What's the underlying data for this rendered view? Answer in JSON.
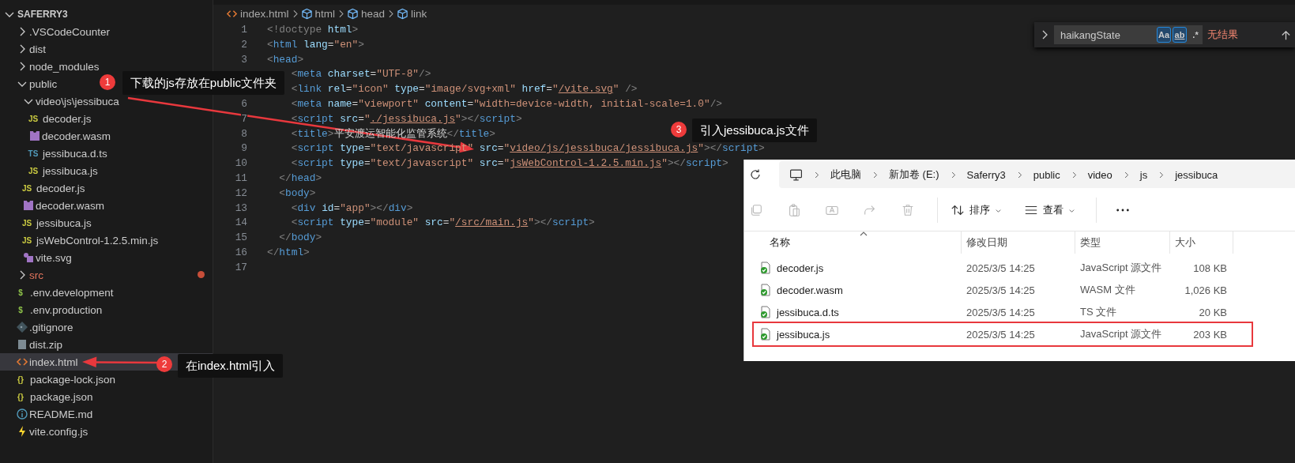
{
  "sidebar": {
    "root": {
      "title": "SAFERRY3",
      "expanded": true
    },
    "items": [
      {
        "name": ".VSCodeCounter",
        "kind": "folder",
        "expanded": false,
        "selected": false,
        "modified": false
      },
      {
        "name": "dist",
        "kind": "folder",
        "expanded": false,
        "selected": false,
        "modified": false
      },
      {
        "name": "node_modules",
        "kind": "folder",
        "expanded": false,
        "selected": false,
        "modified": false
      },
      {
        "name": "public",
        "kind": "folder",
        "expanded": true,
        "selected": false,
        "modified": false,
        "children": [
          {
            "name": "video\\js\\jessibuca",
            "kind": "folder",
            "expanded": true,
            "selected": false,
            "modified": false,
            "children": [
              {
                "name": "decoder.js",
                "kind": "js",
                "icon_text": "JS",
                "selected": false,
                "modified": false
              },
              {
                "name": "decoder.wasm",
                "kind": "wasm",
                "selected": false,
                "modified": false
              },
              {
                "name": "jessibuca.d.ts",
                "kind": "ts",
                "icon_text": "TS",
                "selected": false,
                "modified": false
              },
              {
                "name": "jessibuca.js",
                "kind": "js",
                "icon_text": "JS",
                "selected": false,
                "modified": false
              }
            ]
          },
          {
            "name": "decoder.js",
            "kind": "js",
            "icon_text": "JS",
            "selected": false,
            "modified": false
          },
          {
            "name": "decoder.wasm",
            "kind": "wasm",
            "selected": false,
            "modified": false
          },
          {
            "name": "jessibuca.js",
            "kind": "js",
            "icon_text": "JS",
            "selected": false,
            "modified": false
          },
          {
            "name": "jsWebControl-1.2.5.min.js",
            "kind": "js",
            "icon_text": "JS",
            "selected": false,
            "modified": false
          },
          {
            "name": "vite.svg",
            "kind": "svg",
            "selected": false,
            "modified": false
          }
        ]
      },
      {
        "name": "src",
        "kind": "folder",
        "expanded": false,
        "selected": false,
        "modified": true
      },
      {
        "name": ".env.development",
        "kind": "env",
        "icon_text": "$",
        "selected": false,
        "modified": false
      },
      {
        "name": ".env.production",
        "kind": "env",
        "icon_text": "$",
        "selected": false,
        "modified": false
      },
      {
        "name": ".gitignore",
        "kind": "git",
        "selected": false,
        "modified": false
      },
      {
        "name": "dist.zip",
        "kind": "zip",
        "selected": false,
        "modified": false
      },
      {
        "name": "index.html",
        "kind": "html",
        "selected": true,
        "modified": false
      },
      {
        "name": "package-lock.json",
        "kind": "json",
        "icon_text": "{}",
        "selected": false,
        "modified": false
      },
      {
        "name": "package.json",
        "kind": "json",
        "icon_text": "{}",
        "selected": false,
        "modified": false
      },
      {
        "name": "README.md",
        "kind": "info",
        "selected": false,
        "modified": false
      },
      {
        "name": "vite.config.js",
        "kind": "vite",
        "selected": false,
        "modified": false
      }
    ]
  },
  "breadcrumb": [
    {
      "kind": "file",
      "label": "index.html"
    },
    {
      "kind": "element",
      "label": "html"
    },
    {
      "kind": "element",
      "label": "head"
    },
    {
      "kind": "element",
      "label": "link"
    }
  ],
  "editor": {
    "lines": [
      {
        "number": "1",
        "tokens": [
          {
            "kind": "p",
            "text": "<!doctype"
          },
          {
            "kind": "attr",
            "text": " html"
          },
          {
            "kind": "p",
            "text": ">"
          }
        ]
      },
      {
        "number": "2",
        "tokens": [
          {
            "kind": "p",
            "text": "<"
          },
          {
            "kind": "tag",
            "text": "html"
          },
          {
            "kind": "attr",
            "text": " lang"
          },
          {
            "kind": "t",
            "text": "="
          },
          {
            "kind": "str",
            "text": "\"en\""
          },
          {
            "kind": "p",
            "text": ">"
          }
        ]
      },
      {
        "number": "3",
        "tokens": [
          {
            "kind": "p",
            "text": "<"
          },
          {
            "kind": "tag",
            "text": "head"
          },
          {
            "kind": "p",
            "text": ">"
          }
        ]
      },
      {
        "tokens": [
          {
            "kind": "p",
            "text": "    <"
          },
          {
            "kind": "tag",
            "text": "meta"
          },
          {
            "kind": "attr",
            "text": " charset"
          },
          {
            "kind": "t",
            "text": "="
          },
          {
            "kind": "str",
            "text": "\"UTF-8\""
          },
          {
            "kind": "p",
            "text": "/>"
          }
        ]
      },
      {
        "tokens": [
          {
            "kind": "p",
            "text": "    <"
          },
          {
            "kind": "tag",
            "text": "link"
          },
          {
            "kind": "attr",
            "text": " rel"
          },
          {
            "kind": "t",
            "text": "="
          },
          {
            "kind": "str",
            "text": "\"icon\""
          },
          {
            "kind": "attr",
            "text": " type"
          },
          {
            "kind": "t",
            "text": "="
          },
          {
            "kind": "str",
            "text": "\"image/svg+xml\""
          },
          {
            "kind": "attr",
            "text": " href"
          },
          {
            "kind": "t",
            "text": "="
          },
          {
            "kind": "str",
            "text": "\""
          },
          {
            "kind": "url",
            "text": "/vite.svg"
          },
          {
            "kind": "str",
            "text": "\""
          },
          {
            "kind": "p",
            "text": " />"
          }
        ]
      },
      {
        "number": "6",
        "tokens": [
          {
            "kind": "p",
            "text": "    <"
          },
          {
            "kind": "tag",
            "text": "meta"
          },
          {
            "kind": "attr",
            "text": " name"
          },
          {
            "kind": "t",
            "text": "="
          },
          {
            "kind": "str",
            "text": "\"viewport\""
          },
          {
            "kind": "attr",
            "text": " content"
          },
          {
            "kind": "t",
            "text": "="
          },
          {
            "kind": "str",
            "text": "\"width=device-width, initial-scale=1.0\""
          },
          {
            "kind": "p",
            "text": "/>"
          }
        ]
      },
      {
        "number": "7",
        "tokens": [
          {
            "kind": "p",
            "text": "    <"
          },
          {
            "kind": "tag",
            "text": "script"
          },
          {
            "kind": "attr",
            "text": " src"
          },
          {
            "kind": "t",
            "text": "="
          },
          {
            "kind": "str",
            "text": "\""
          },
          {
            "kind": "url",
            "text": "./jessibuca.js"
          },
          {
            "kind": "str",
            "text": "\""
          },
          {
            "kind": "p",
            "text": "></"
          },
          {
            "kind": "tag",
            "text": "script"
          },
          {
            "kind": "p",
            "text": ">"
          }
        ]
      },
      {
        "number": "8",
        "tokens": [
          {
            "kind": "p",
            "text": "    <"
          },
          {
            "kind": "tag",
            "text": "title"
          },
          {
            "kind": "p",
            "text": ">"
          },
          {
            "kind": "t",
            "text": "平安渡运智能化监管系统"
          },
          {
            "kind": "p",
            "text": "</"
          },
          {
            "kind": "tag",
            "text": "title"
          },
          {
            "kind": "p",
            "text": ">"
          }
        ]
      },
      {
        "number": "9",
        "tokens": [
          {
            "kind": "p",
            "text": "    <"
          },
          {
            "kind": "tag",
            "text": "script"
          },
          {
            "kind": "attr",
            "text": " type"
          },
          {
            "kind": "t",
            "text": "="
          },
          {
            "kind": "str",
            "text": "\"text/javascript\""
          },
          {
            "kind": "attr",
            "text": " src"
          },
          {
            "kind": "t",
            "text": "="
          },
          {
            "kind": "str",
            "text": "\""
          },
          {
            "kind": "url",
            "text": "video/js/jessibuca/jessibuca.js"
          },
          {
            "kind": "str",
            "text": "\""
          },
          {
            "kind": "p",
            "text": "></"
          },
          {
            "kind": "tag",
            "text": "script"
          },
          {
            "kind": "p",
            "text": ">"
          }
        ]
      },
      {
        "number": "10",
        "tokens": [
          {
            "kind": "p",
            "text": "    <"
          },
          {
            "kind": "tag",
            "text": "script"
          },
          {
            "kind": "attr",
            "text": " type"
          },
          {
            "kind": "t",
            "text": "="
          },
          {
            "kind": "str",
            "text": "\"text/javascript\""
          },
          {
            "kind": "attr",
            "text": " src"
          },
          {
            "kind": "t",
            "text": "="
          },
          {
            "kind": "str",
            "text": "\""
          },
          {
            "kind": "url",
            "text": "jsWebControl-1.2.5.min.js"
          },
          {
            "kind": "str",
            "text": "\""
          },
          {
            "kind": "p",
            "text": "></"
          },
          {
            "kind": "tag",
            "text": "script"
          },
          {
            "kind": "p",
            "text": ">"
          }
        ]
      },
      {
        "number": "11",
        "tokens": [
          {
            "kind": "p",
            "text": "  </"
          },
          {
            "kind": "tag",
            "text": "head"
          },
          {
            "kind": "p",
            "text": ">"
          }
        ]
      },
      {
        "number": "12",
        "tokens": [
          {
            "kind": "p",
            "text": "  <"
          },
          {
            "kind": "tag",
            "text": "body"
          },
          {
            "kind": "p",
            "text": ">"
          }
        ]
      },
      {
        "number": "13",
        "tokens": [
          {
            "kind": "p",
            "text": "    <"
          },
          {
            "kind": "tag",
            "text": "div"
          },
          {
            "kind": "attr",
            "text": " id"
          },
          {
            "kind": "t",
            "text": "="
          },
          {
            "kind": "str",
            "text": "\"app\""
          },
          {
            "kind": "p",
            "text": "></"
          },
          {
            "kind": "tag",
            "text": "div"
          },
          {
            "kind": "p",
            "text": ">"
          }
        ]
      },
      {
        "number": "14",
        "tokens": [
          {
            "kind": "p",
            "text": "    <"
          },
          {
            "kind": "tag",
            "text": "script"
          },
          {
            "kind": "attr",
            "text": " type"
          },
          {
            "kind": "t",
            "text": "="
          },
          {
            "kind": "str",
            "text": "\"module\""
          },
          {
            "kind": "attr",
            "text": " src"
          },
          {
            "kind": "t",
            "text": "="
          },
          {
            "kind": "str",
            "text": "\""
          },
          {
            "kind": "url",
            "text": "/src/main.js"
          },
          {
            "kind": "str",
            "text": "\""
          },
          {
            "kind": "p",
            "text": "></"
          },
          {
            "kind": "tag",
            "text": "script"
          },
          {
            "kind": "p",
            "text": ">"
          }
        ]
      },
      {
        "number": "15",
        "tokens": [
          {
            "kind": "p",
            "text": "  </"
          },
          {
            "kind": "tag",
            "text": "body"
          },
          {
            "kind": "p",
            "text": ">"
          }
        ]
      },
      {
        "number": "16",
        "tokens": [
          {
            "kind": "p",
            "text": "</"
          },
          {
            "kind": "tag",
            "text": "html"
          },
          {
            "kind": "p",
            "text": ">"
          }
        ]
      },
      {
        "number": "17"
      }
    ]
  },
  "find": {
    "value": "haikangState",
    "match_case": true,
    "whole_word": true,
    "regex": false,
    "case_label": "Aa",
    "word_label": "ab",
    "regex_label": ".*",
    "result": "无结果"
  },
  "file_explorer": {
    "path": [
      "此电脑",
      "新加卷 (E:)",
      "Saferry3",
      "public",
      "video",
      "js",
      "jessibuca"
    ],
    "actions": [
      {
        "disabled": true
      },
      {
        "disabled": true
      },
      {
        "disabled": true
      },
      {
        "disabled": true
      },
      {
        "disabled": true
      }
    ],
    "sort_label": "排序",
    "view_label": "查看",
    "columns": [
      {
        "label": "名称",
        "sorted": true
      },
      {
        "label": "修改日期",
        "sorted": false
      },
      {
        "label": "类型",
        "sorted": false
      },
      {
        "label": "大小",
        "sorted": false
      }
    ],
    "files": [
      {
        "name": "decoder.js",
        "date": "2025/3/5 14:25",
        "type": "JavaScript 源文件",
        "size": "108 KB",
        "boxed": false
      },
      {
        "name": "decoder.wasm",
        "date": "2025/3/5 14:25",
        "type": "WASM 文件",
        "size": "1,026 KB",
        "boxed": false
      },
      {
        "name": "jessibuca.d.ts",
        "date": "2025/3/5 14:25",
        "type": "TS 文件",
        "size": "20 KB",
        "boxed": false
      },
      {
        "name": "jessibuca.js",
        "date": "2025/3/5 14:25",
        "type": "JavaScript 源文件",
        "size": "203 KB",
        "boxed": true
      }
    ]
  },
  "annotations": [
    {
      "number": "1",
      "text": "下载的js存放在public文件夹"
    },
    {
      "number": "2",
      "text": "在index.html引入"
    },
    {
      "number": "3",
      "text": "引入jessibuca.js文件"
    }
  ]
}
